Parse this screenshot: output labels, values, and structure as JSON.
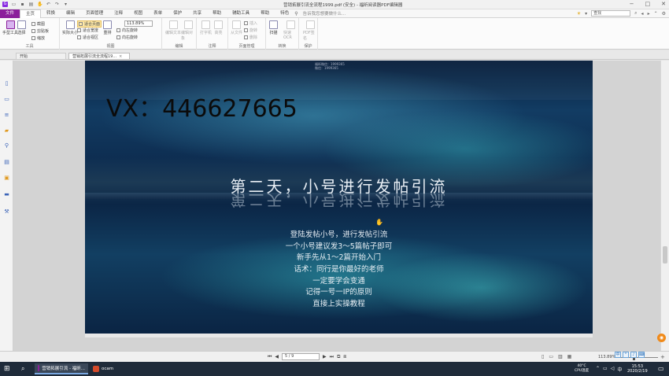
{
  "window": {
    "title": "营销拓展引流全流程1999.pdf (安全) - 福昕阅读器PDF编辑器"
  },
  "menu": {
    "items": [
      "文件",
      "主页",
      "转换",
      "编辑",
      "页面管理",
      "注释",
      "视图",
      "表单",
      "保护",
      "共享",
      "帮助",
      "辅助工具",
      "帮助",
      "特色"
    ],
    "tell_me": "告诉我您想要做什么...",
    "find_placeholder": "查找"
  },
  "ribbon": {
    "hand_tool": "手型工具",
    "select": "选择",
    "snapshot": "截图",
    "clipboard": "剪贴板",
    "zoom": "缩放",
    "group_tools": "工具",
    "actual_size": "实际大小",
    "fit_page": "适合页面",
    "fit_width": "适合宽度",
    "fit_visible": "适合视区",
    "reflow": "重排",
    "zoom_value": "113.89%",
    "rotate_left": "向左旋转",
    "rotate_right": "向右旋转",
    "group_view": "视图",
    "edit_text": "编辑文本",
    "edit_object": "编辑对象",
    "group_edit": "编辑",
    "typewriter": "打字机",
    "highlight": "高亮",
    "group_comment": "注释",
    "from_file": "从文件",
    "insert": "插入",
    "rotate": "旋转",
    "delete": "删除",
    "group_pages": "页面管理",
    "scan": "扫描",
    "quick_ocr": "快速OCR",
    "group_convert": "转换",
    "pdf_sign": "PDF签名",
    "group_protect": "保护"
  },
  "tabs": {
    "start": "开始",
    "doc": "营销拓展引流全流程19...",
    "close": "×"
  },
  "page": {
    "watermark_line1": "福昕微信：1999365",
    "watermark_line2": "微信：1999365",
    "vx": "VX：446627665",
    "headline": "第二天，小号进行发帖引流",
    "lines": [
      "登陆发帖小号，进行发帖引流",
      "一个小号建议发3～5篇帖子即可",
      "新手先从1～2篇开始入门",
      "话术：同行是你最好的老师",
      "一定要学会变通",
      "记得一号一IP的原则",
      "直接上实操教程"
    ]
  },
  "status": {
    "page_indicator": "5 / 9",
    "zoom": "113.89%"
  },
  "taskbar": {
    "pdf_app": "营销拓展引流 - 福昕...",
    "ocam": "ocam",
    "temp": "40°C",
    "cpu": "CPU温度",
    "time": "15:53",
    "date": "2020/2/19"
  },
  "colors": {
    "accent": "#8b1f9b",
    "taskbar": "#1f2b3a"
  }
}
